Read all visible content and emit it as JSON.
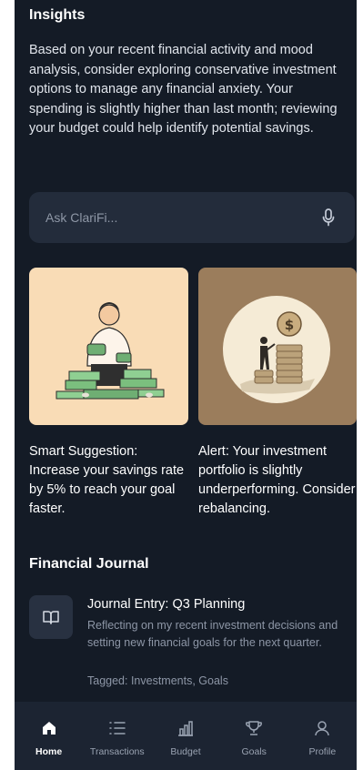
{
  "insights": {
    "title": "Insights",
    "text": "Based on your recent financial activity and mood analysis, consider exploring conservative investment options to manage any financial anxiety. Your spending is slightly higher than last month; reviewing your budget could help identify potential savings."
  },
  "ask": {
    "placeholder": "Ask ClariFi..."
  },
  "cards": [
    {
      "caption": "Smart Suggestion: Increase your savings rate by 5% to reach your goal faster.",
      "illustration": "person-holding-money-illustration"
    },
    {
      "caption": "Alert: Your investment portfolio is slightly underperforming. Consider rebalancing.",
      "illustration": "investor-coin-stack-illustration"
    }
  ],
  "journal": {
    "title": "Financial Journal",
    "entry": {
      "title": "Journal Entry: Q3 Planning",
      "description": "Reflecting on my recent investment decisions and setting new financial goals for the next quarter.",
      "tags": "Tagged: Investments, Goals",
      "icon": "book-icon"
    }
  },
  "tabs": [
    {
      "label": "Home",
      "icon": "home-icon",
      "active": true
    },
    {
      "label": "Transactions",
      "icon": "list-icon",
      "active": false
    },
    {
      "label": "Budget",
      "icon": "bar-chart-icon",
      "active": false
    },
    {
      "label": "Goals",
      "icon": "trophy-icon",
      "active": false
    },
    {
      "label": "Profile",
      "icon": "user-icon",
      "active": false
    }
  ],
  "colors": {
    "background": "#141b26",
    "card_left": "#f9dcb6",
    "card_right": "#9b7d5c",
    "tabbar": "#1c2432"
  }
}
